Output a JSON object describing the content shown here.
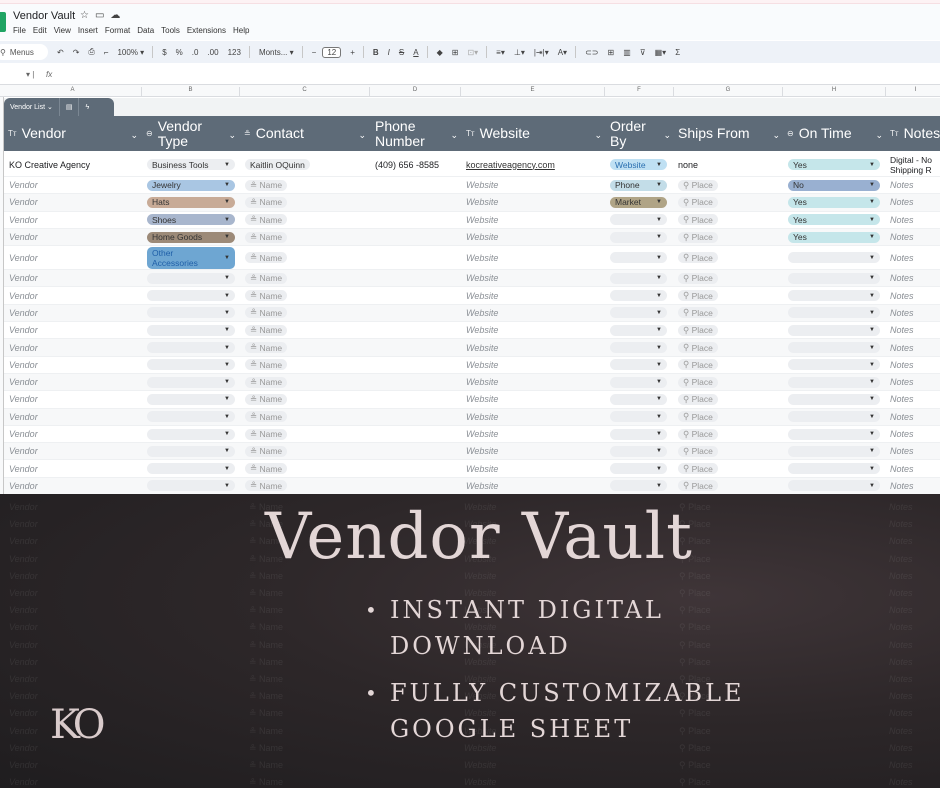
{
  "app": {
    "title": "Vendor Vault",
    "title_icons": [
      "star-icon",
      "folder-icon",
      "cloud-icon"
    ],
    "menu": [
      "File",
      "Edit",
      "View",
      "Insert",
      "Format",
      "Data",
      "Tools",
      "Extensions",
      "Help"
    ]
  },
  "toolbar": {
    "search_label": "Menus",
    "zoom": "100%",
    "currency": "$",
    "percent": "%",
    "dec_decrease": ".0",
    "dec_increase": ".00",
    "number_format": "123",
    "font": "Monts...",
    "font_size": "12",
    "bold": "B",
    "italic": "I",
    "strike": "S",
    "text_color": "A",
    "sum": "Σ"
  },
  "formula_bar": {
    "fx": "fx",
    "value": ""
  },
  "columns": [
    "A",
    "B",
    "C",
    "D",
    "E",
    "F",
    "G",
    "H",
    "I"
  ],
  "table": {
    "name": "Vendor List",
    "headers": [
      {
        "label": "Vendor",
        "icon": "text-type-icon"
      },
      {
        "label": "Vendor Type",
        "icon": "dropdown-type-icon"
      },
      {
        "label": "Contact",
        "icon": "person-icon"
      },
      {
        "label": "Phone Number",
        "icon": ""
      },
      {
        "label": "Website",
        "icon": "text-type-icon"
      },
      {
        "label": "Order By",
        "icon": ""
      },
      {
        "label": "Ships From",
        "icon": ""
      },
      {
        "label": "On Time",
        "icon": "dropdown-type-icon"
      },
      {
        "label": "Notes",
        "icon": "text-type-icon"
      }
    ],
    "first_row": {
      "vendor": "KO Creative Agency",
      "vendor_type": "Business Tools",
      "contact": "Kaitlin OQuinn",
      "phone": "(409) 656 -8585",
      "website": "kocreativeagency.com",
      "order_by": "Website",
      "ships_from": "none",
      "on_time": "Yes",
      "notes": "Digital - No Shipping R"
    },
    "placeholders": {
      "vendor": "Vendor",
      "contact": "Name",
      "website": "Website",
      "ships_from": "Place",
      "notes": "Notes"
    },
    "rows": [
      {
        "vendor_type": "Jewelry",
        "order_by": "Phone",
        "on_time": "No"
      },
      {
        "vendor_type": "Hats",
        "order_by": "Market",
        "on_time": "Yes"
      },
      {
        "vendor_type": "Shoes",
        "order_by": "",
        "on_time": "Yes"
      },
      {
        "vendor_type": "Home Goods",
        "order_by": "",
        "on_time": "Yes"
      },
      {
        "vendor_type": "Other Accessories",
        "order_by": "",
        "on_time": ""
      },
      {
        "vendor_type": "",
        "order_by": "",
        "on_time": ""
      },
      {
        "vendor_type": "",
        "order_by": "",
        "on_time": ""
      },
      {
        "vendor_type": "",
        "order_by": "",
        "on_time": ""
      },
      {
        "vendor_type": "",
        "order_by": "",
        "on_time": ""
      },
      {
        "vendor_type": "",
        "order_by": "",
        "on_time": ""
      },
      {
        "vendor_type": "",
        "order_by": "",
        "on_time": ""
      },
      {
        "vendor_type": "",
        "order_by": "",
        "on_time": ""
      },
      {
        "vendor_type": "",
        "order_by": "",
        "on_time": ""
      },
      {
        "vendor_type": "",
        "order_by": "",
        "on_time": ""
      },
      {
        "vendor_type": "",
        "order_by": "",
        "on_time": ""
      },
      {
        "vendor_type": "",
        "order_by": "",
        "on_time": ""
      },
      {
        "vendor_type": "",
        "order_by": "",
        "on_time": ""
      },
      {
        "vendor_type": "",
        "order_by": "",
        "on_time": ""
      }
    ],
    "chip_colors": {
      "Business Tools": "#eceef1",
      "Jewelry": "#a9c6e3",
      "Hats": "#c8ab97",
      "Shoes": "#a8b6cd",
      "Home Goods": "#9c8a78",
      "Other Accessories": "#6ea6d2",
      "Website": "#bfe0f3",
      "Phone": "#c3dde8",
      "Market": "#b0a486",
      "Yes": "#c5e6ea",
      "No": "#99b0d1",
      "": "#eceef1"
    },
    "header_color": "#5e6b78"
  },
  "promo": {
    "title": "Vendor Vault",
    "bullets": [
      "INSTANT DIGITAL DOWNLOAD",
      "FULLY CUSTOMIZABLE GOOGLE SHEET"
    ],
    "logo": "KO"
  }
}
